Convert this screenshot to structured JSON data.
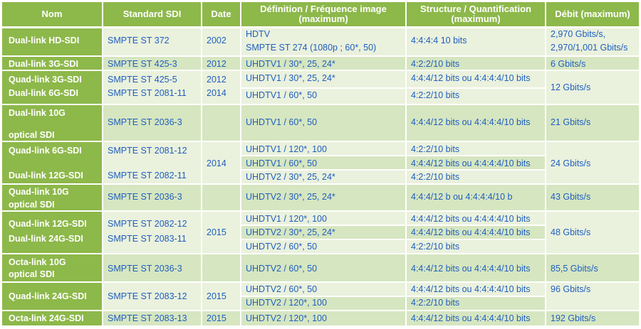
{
  "headers": {
    "nom": "Nom",
    "standard": "Standard SDI",
    "date": "Date",
    "definition_l1": "Définition / Fréquence image",
    "definition_l2": "(maximum)",
    "structure_l1": "Structure / Quantification",
    "structure_l2": "(maximum)",
    "debit": "Débit (maximum)"
  },
  "rows": [
    {
      "nom": [
        "Dual-link HD-SDI"
      ],
      "standards": [
        "SMPTE ST 372"
      ],
      "dates": [
        "2002"
      ],
      "definitions": [
        "HDTV",
        "SMPTE ST 274 (1080p ; 60*, 50)"
      ],
      "structures": [
        "4:4:4:4 10 bits"
      ],
      "debit": [
        "2,970 Gbits/s,",
        "2,970/1,001 Gbits/s"
      ]
    },
    {
      "nom": [
        "Dual-link 3G-SDI"
      ],
      "standards": [
        "SMPTE ST 425-3"
      ],
      "dates": [
        "2012"
      ],
      "definitions": [
        "UHDTV1 / 30*, 25, 24*"
      ],
      "structures": [
        "4:2:2/10 bits"
      ],
      "debit": [
        "6 Gbits/s"
      ]
    },
    {
      "nom": [
        "Quad-link 3G-SDI",
        "Dual-link 6G-SDI"
      ],
      "standards": [
        "SMPTE ST 425-5",
        "SMPTE ST 2081-11"
      ],
      "dates": [
        "2012",
        "2014"
      ],
      "definitions": [
        "UHDTV1 / 30*, 25, 24*",
        "UHDTV1 / 60*, 50"
      ],
      "structures": [
        "4:4:4/12 bits ou 4:4:4:4/10 bits",
        "4:2:2/10 bits"
      ],
      "debit": [
        "12 Gbits/s"
      ]
    },
    {
      "nom": [
        "Dual-link 10G",
        "optical SDI"
      ],
      "standards": [
        "SMPTE ST 2036-3"
      ],
      "dates": [],
      "definitions": [
        "UHDTV1 / 60*, 50"
      ],
      "structures": [
        "4:4:4/12 bits ou 4:4:4:4/10 bits"
      ],
      "debit": [
        "21 Gbits/s"
      ]
    },
    {
      "nom": [
        "Quad-link 6G-SDI",
        "Dual-link 12G-SDI"
      ],
      "standards": [
        "SMPTE ST 2081-12",
        "SMPTE ST 2082-11"
      ],
      "dates": [
        "2014"
      ],
      "definitions": [
        "UHDTV1 / 120*, 100",
        "UHDTV1 / 60*, 50",
        "UHDTV2 / 30*, 25, 24*"
      ],
      "structures": [
        "4:2:2/10 bits",
        "4:4:4/12 bits ou 4:4:4:4/10 bits",
        "4:2:2/10 bits"
      ],
      "debit": [
        "24 Gbits/s"
      ]
    },
    {
      "nom": [
        "Quad-link 10G",
        "optical SDI"
      ],
      "standards": [
        "SMPTE ST 2036-3"
      ],
      "dates": [],
      "definitions": [
        "UHDTV2 / 30*, 25, 24*"
      ],
      "structures": [
        "4:4:4/12 b ou 4:4:4:4/10 b"
      ],
      "debit": [
        "43 Gbits/s"
      ]
    },
    {
      "nom": [
        "Quad-link 12G-SDI",
        "Dual-link 24G-SDI"
      ],
      "standards": [
        "SMPTE ST 2082-12",
        "SMPTE ST 2083-11"
      ],
      "dates": [
        "2015"
      ],
      "definitions": [
        "UHDTV1 / 120*, 100",
        "UHDTV2 / 30*, 25, 24*",
        "UHDTV2 / 60*, 50"
      ],
      "structures": [
        "4:4:4/12 bits ou 4:4:4:4/10 bits",
        "4:4:4/12 bits ou 4:4:4:4/10 bits",
        "4:2:2/10 bits"
      ],
      "debit": [
        "48 Gbits/s"
      ]
    },
    {
      "nom": [
        "Octa-link 10G",
        "optical SDI"
      ],
      "standards": [
        "SMPTE ST 2036-3"
      ],
      "dates": [],
      "definitions": [
        "UHDTV2 / 60*, 50"
      ],
      "structures": [
        "4:4:4/12 bits ou 4:4:4:4/10 bits"
      ],
      "debit": [
        "85,5 Gbits/s"
      ]
    },
    {
      "nom": [
        "Quad-link 24G-SDI"
      ],
      "standards": [
        "SMPTE ST 2083-12"
      ],
      "dates": [
        "2015"
      ],
      "definitions": [
        "UHDTV2 / 60*, 50",
        "UHDTV2 / 120*, 100"
      ],
      "structures": [
        "4:4:4/12 bits ou 4:4:4:4/10 bits",
        "4:2:2/10 bits"
      ],
      "debit": [
        "96 Gbits/s"
      ]
    },
    {
      "nom": [
        "Octa-link 24G-SDI"
      ],
      "standards": [
        "SMPTE ST 2083-13"
      ],
      "dates": [
        "2015"
      ],
      "definitions": [
        "UHDTV2 / 120*, 100"
      ],
      "structures": [
        "4:4:4/12 bits ou 4:4:4:4/10 bits"
      ],
      "debit": [
        "192 Gbits/s"
      ]
    }
  ]
}
